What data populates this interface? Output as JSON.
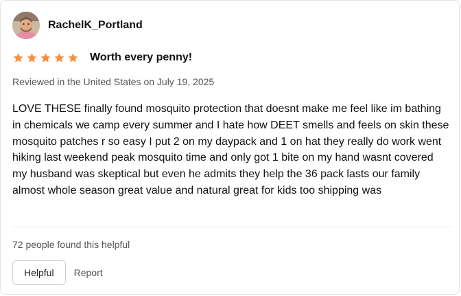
{
  "reviewer": {
    "name": "RachelK_Portland"
  },
  "review": {
    "rating": 5,
    "max_rating": 5,
    "star_color": "#f5903d",
    "title": "Worth every penny!",
    "meta": "Reviewed in the United States on July 19, 2025",
    "body": "LOVE THESE finally found mosquito protection that doesnt make me feel like im bathing in chemicals we camp every summer and I hate how DEET smells and feels on skin these mosquito patches r so easy I put 2 on my daypack and 1 on hat they really do work went hiking last weekend peak mosquito time and only got 1 bite on my hand wasnt covered my husband was skeptical but even he admits they help the 36 pack lasts our family almost whole season great value and natural great for kids too shipping was"
  },
  "footer": {
    "helpful_count": "72 people found this helpful",
    "helpful_button": "Helpful",
    "report_link": "Report"
  }
}
